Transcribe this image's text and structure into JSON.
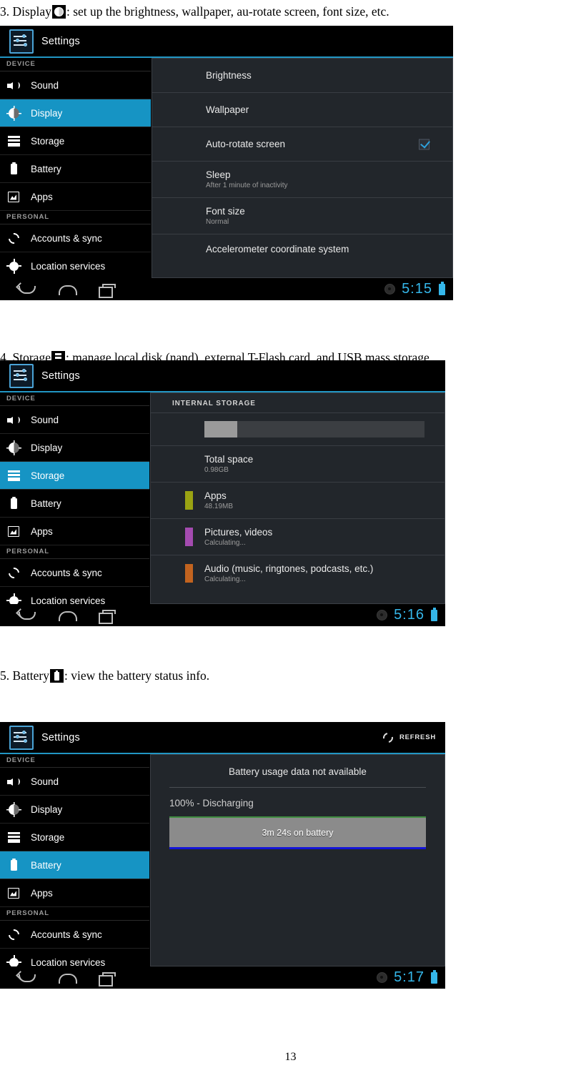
{
  "document": {
    "page_number": "13",
    "paragraphs": [
      {
        "id": "p3",
        "prefix": "3.  Display",
        "icon": "display-icon",
        "suffix": ": set up the brightness, wallpaper, au-rotate screen, font size, etc."
      },
      {
        "id": "p4",
        "prefix": "4.  Storage",
        "icon": "storage-icon",
        "suffix": ": manage  local  disk  (nand),  external  T-Flash  card,  and  USB  mass  storage"
      },
      {
        "id": "p5",
        "prefix": "5. Battery",
        "icon": "battery-icon",
        "suffix": ":  view  the  battery  status  info."
      }
    ]
  },
  "colors": {
    "accent_blue": "#1694c4",
    "topbar_underline": "#2196c4",
    "clock_blue": "#35b7ea",
    "panel_bg": "#22262b",
    "apps_swatch": "#9aa312",
    "pictures_swatch": "#a44bb0",
    "audio_swatch": "#c2631f",
    "battery_chart_top": "#3f8b3f",
    "battery_chart_bottom": "#1414d8",
    "battery_chart_fill": "#8b8b8b"
  },
  "screens": [
    {
      "id": "display-screen",
      "topbar": {
        "title": "Settings",
        "logo": "settings-sliders-icon"
      },
      "sidebar": {
        "sections": [
          {
            "header": "DEVICE",
            "items": [
              {
                "label": "Sound",
                "icon": "sound-icon",
                "active": false
              },
              {
                "label": "Display",
                "icon": "display-icon",
                "active": true
              },
              {
                "label": "Storage",
                "icon": "storage-icon",
                "active": false
              },
              {
                "label": "Battery",
                "icon": "battery-icon",
                "active": false
              },
              {
                "label": "Apps",
                "icon": "apps-icon",
                "active": false
              }
            ]
          },
          {
            "header": "PERSONAL",
            "items": [
              {
                "label": "Accounts & sync",
                "icon": "sync-icon",
                "active": false
              },
              {
                "label": "Location services",
                "icon": "location-icon",
                "active": false
              }
            ]
          }
        ]
      },
      "detail": {
        "rows": [
          {
            "title": "Brightness",
            "sub": "",
            "checked": null
          },
          {
            "title": "Wallpaper",
            "sub": "",
            "checked": null
          },
          {
            "title": "Auto-rotate screen",
            "sub": "",
            "checked": true
          },
          {
            "title": "Sleep",
            "sub": "After 1 minute of inactivity",
            "checked": null
          },
          {
            "title": "Font size",
            "sub": "Normal",
            "checked": null
          },
          {
            "title": "Accelerometer coordinate system",
            "sub": "",
            "checked": null
          }
        ]
      },
      "navbar": {
        "back": "back-icon",
        "home": "home-icon",
        "recents": "recents-icon",
        "clock": "5:15",
        "battery": "battery-status-icon"
      }
    },
    {
      "id": "storage-screen",
      "topbar": {
        "title": "Settings",
        "logo": "settings-sliders-icon"
      },
      "sidebar": {
        "sections": [
          {
            "header": "DEVICE",
            "items": [
              {
                "label": "Sound",
                "icon": "sound-icon",
                "active": false
              },
              {
                "label": "Display",
                "icon": "display-icon",
                "active": false
              },
              {
                "label": "Storage",
                "icon": "storage-icon",
                "active": true
              },
              {
                "label": "Battery",
                "icon": "battery-icon",
                "active": false
              },
              {
                "label": "Apps",
                "icon": "apps-icon",
                "active": false
              }
            ]
          },
          {
            "header": "PERSONAL",
            "items": [
              {
                "label": "Accounts & sync",
                "icon": "sync-icon",
                "active": false
              },
              {
                "label": "Location services",
                "icon": "location-icon",
                "active": false
              }
            ]
          }
        ]
      },
      "detail": {
        "section_header": "INTERNAL STORAGE",
        "usage_bar_percent": 15,
        "rows": [
          {
            "title": "Total space",
            "sub": "0.98GB",
            "swatch": null
          },
          {
            "title": "Apps",
            "sub": "48.19MB",
            "swatch": "#9aa312"
          },
          {
            "title": "Pictures, videos",
            "sub": "Calculating...",
            "swatch": "#a44bb0"
          },
          {
            "title": "Audio (music, ringtones, podcasts, etc.)",
            "sub": "Calculating...",
            "swatch": "#c2631f"
          }
        ]
      },
      "navbar": {
        "back": "back-icon",
        "home": "home-icon",
        "recents": "recents-icon",
        "clock": "5:16",
        "battery": "battery-status-icon"
      }
    },
    {
      "id": "battery-screen",
      "topbar": {
        "title": "Settings",
        "logo": "settings-sliders-icon",
        "refresh_label": "REFRESH",
        "refresh_icon": "refresh-icon"
      },
      "sidebar": {
        "sections": [
          {
            "header": "DEVICE",
            "items": [
              {
                "label": "Sound",
                "icon": "sound-icon",
                "active": false
              },
              {
                "label": "Display",
                "icon": "display-icon",
                "active": false
              },
              {
                "label": "Storage",
                "icon": "storage-icon",
                "active": false
              },
              {
                "label": "Battery",
                "icon": "battery-icon",
                "active": true
              },
              {
                "label": "Apps",
                "icon": "apps-icon",
                "active": false
              }
            ]
          },
          {
            "header": "PERSONAL",
            "items": [
              {
                "label": "Accounts & sync",
                "icon": "sync-icon",
                "active": false
              },
              {
                "label": "Location services",
                "icon": "location-icon",
                "active": false
              }
            ]
          }
        ]
      },
      "detail": {
        "message": "Battery usage data not available",
        "percent_status": "100% - Discharging",
        "chart_label": "3m 24s on battery"
      },
      "navbar": {
        "back": "back-icon",
        "home": "home-icon",
        "recents": "recents-icon",
        "clock": "5:17",
        "battery": "battery-status-icon"
      }
    }
  ]
}
